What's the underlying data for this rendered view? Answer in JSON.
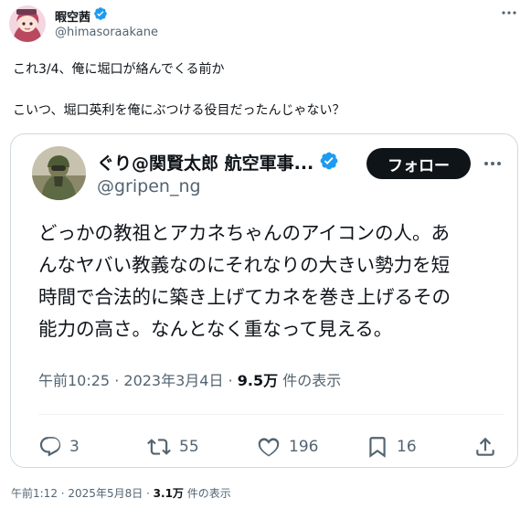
{
  "outer_post": {
    "display_name": "暇空茜",
    "handle": "@himasoraakane",
    "text_lines": [
      "これ3/4、俺に堀口が絡んでくる前か",
      "こいつ、堀口英利を俺にぶつける役目だったんじゃない？"
    ],
    "time": "午前1:12",
    "date": "2025年5月8日",
    "views": "3.1万",
    "views_suffix": "件の表示",
    "sep": " · "
  },
  "quoted_post": {
    "display_name": "ぐり@関賢太郎 航空軍事...",
    "handle": "@gripen_ng",
    "follow_label": "フォロー",
    "body_lines": [
      "どっかの教祖とアカネちゃんのアイコンの人。あ",
      "んなヤバい教義なのにそれなりの大きい勢力を短",
      "時間で合法的に築き上げてカネを巻き上げるその",
      "能力の高さ。なんとなく重なって見える。"
    ],
    "time": "午前10:25",
    "date": "2023年3月4日",
    "views": "9.5万",
    "views_suffix": "件の表示",
    "sep": " · ",
    "actions": {
      "replies": "3",
      "reposts": "55",
      "likes": "196",
      "bookmarks": "16"
    }
  },
  "colors": {
    "text": "#0f1419",
    "secondary": "#536471",
    "verified": "#1d9bf0",
    "border": "#cfd9de"
  },
  "icons": [
    "verified-badge-icon",
    "more-options-icon",
    "reply-icon",
    "repost-icon",
    "like-icon",
    "bookmark-icon",
    "share-icon"
  ]
}
